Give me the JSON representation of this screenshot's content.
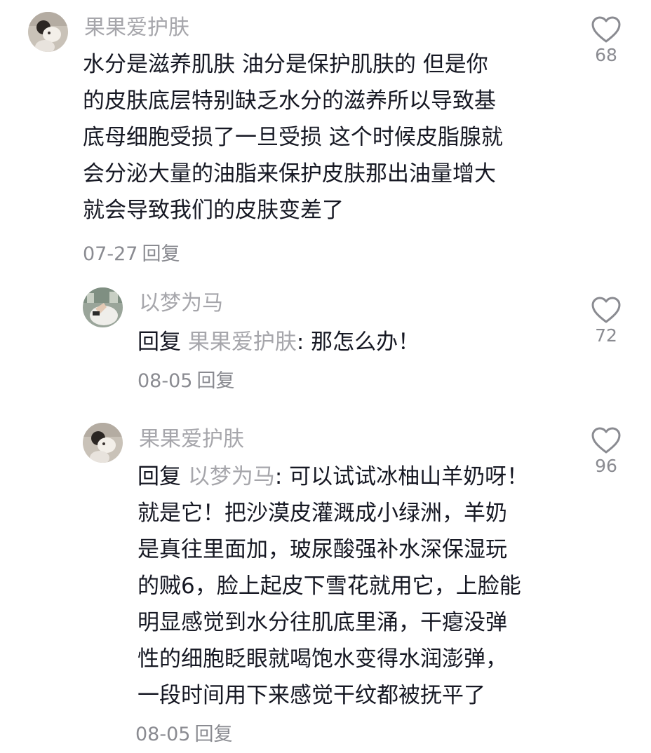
{
  "comments": [
    {
      "username": "果果爱护肤",
      "lines": [
        "水分是滋养肌肤 油分是保护肌肤的 但是你",
        "的皮肤底层特别缺乏水分的滋养所以导致基",
        "底母细胞受损了一旦受损 这个时候皮脂腺就",
        "会分泌大量的油脂来保护皮肤那出油量增大",
        "就会导致我们的皮肤变差了"
      ],
      "date": "07-27",
      "reply_label": "回复",
      "likes": "68"
    },
    {
      "username": "以梦为马",
      "reply_prefix": "回复",
      "reply_target": "果果爱护肤",
      "first_line_text": ": 那怎么办！",
      "date": "08-05",
      "reply_label": "回复",
      "likes": "72"
    },
    {
      "username": "果果爱护肤",
      "reply_prefix": "回复",
      "reply_target": "以梦为马",
      "first_line_text": ": 可以试试冰柚山羊奶呀！",
      "lines": [
        "就是它！把沙漠皮灌溉成小绿洲，羊奶",
        "是真往里面加，玻尿酸强补水深保湿玩",
        "的贼6，脸上起皮下雪花就用它，上脸能",
        "明显感觉到水分往肌底里涌，干瘪没弹",
        "性的细胞眨眼就喝饱水变得水润澎弹，",
        "一段时间用下来感觉干纹都被抚平了"
      ],
      "date": "08-05",
      "reply_label": "回复",
      "likes": "96"
    }
  ]
}
